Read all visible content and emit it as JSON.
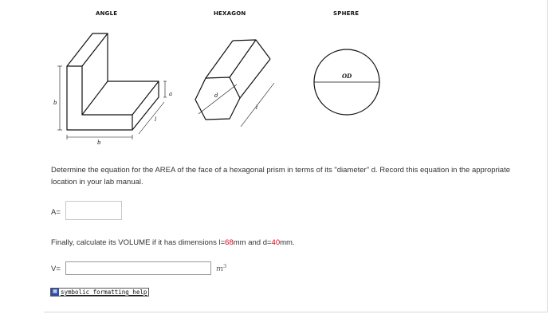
{
  "figures": {
    "angle_title": "ANGLE",
    "hexagon_title": "HEXAGON",
    "sphere_title": "SPHERE",
    "angle_dims": {
      "a": "a",
      "b_side": "b",
      "b_bottom": "b",
      "l": "l"
    },
    "hexagon_dims": {
      "d": "d",
      "l": "l"
    },
    "sphere_dims": {
      "od": "OD"
    }
  },
  "question": {
    "area_prompt": "Determine the equation for the AREA of the face of a hexagonal prism in terms of its \"diameter\" d. Record this equation in the appropriate location in your lab manual.",
    "area_label": "A=",
    "area_value": "",
    "volume_prompt_before_l": "Finally, calculate its VOLUME if it has dimensions l=",
    "l_value": "68",
    "volume_prompt_mid": "mm and d=",
    "d_value": "40",
    "volume_prompt_end": "mm.",
    "volume_label": "V=",
    "volume_value": "",
    "volume_unit": "m",
    "volume_unit_exp": "3"
  },
  "help": {
    "label": "symbolic formatting help",
    "icon": "help-icon"
  },
  "colors": {
    "highlight": "#e0001b",
    "help_icon_bg": "#2d4fa8"
  }
}
